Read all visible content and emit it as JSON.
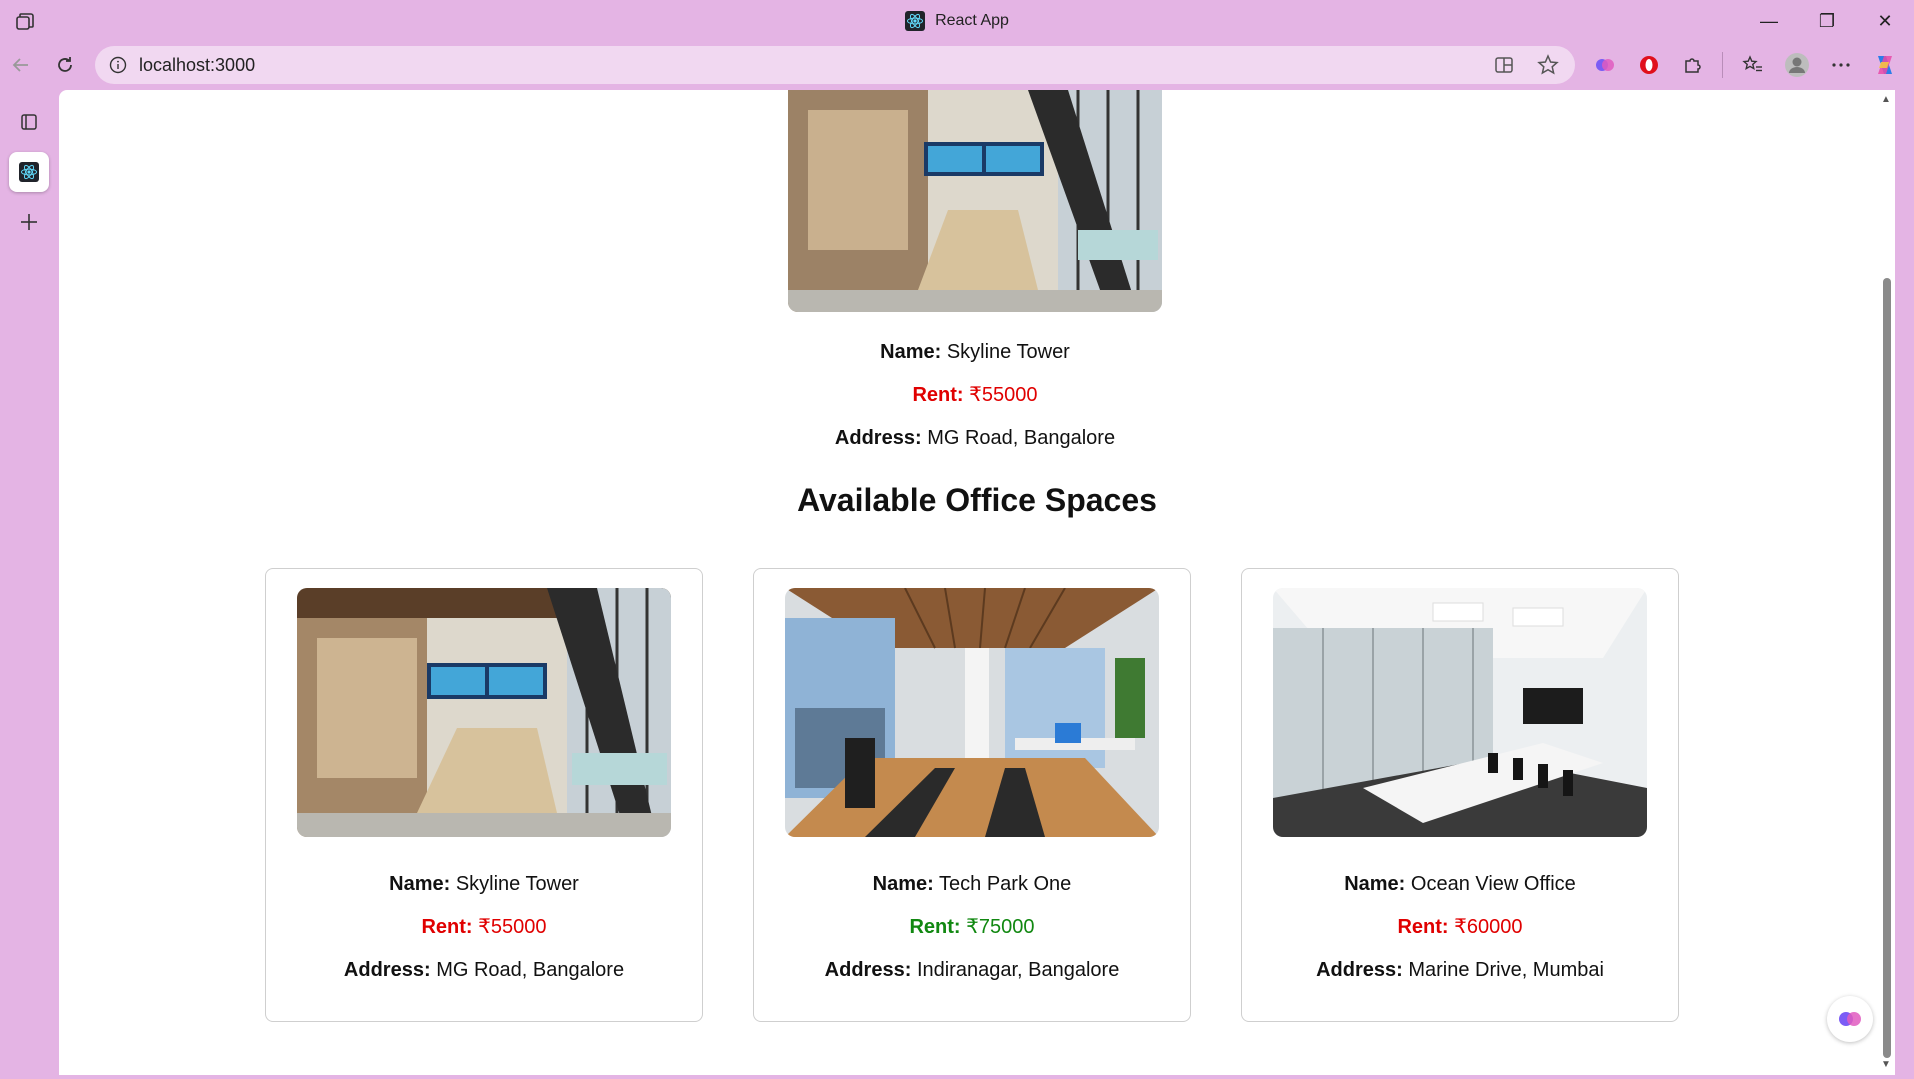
{
  "window": {
    "title": "React App",
    "controls": {
      "minimize": "—",
      "restore": "❐",
      "close": "✕"
    }
  },
  "toolbar": {
    "url": "localhost:3000"
  },
  "featured": {
    "name_label": "Name:",
    "name": "Skyline Tower",
    "rent_label": "Rent:",
    "rent": "₹55000",
    "address_label": "Address:",
    "address": "MG Road, Bangalore"
  },
  "section": {
    "title": "Available Office Spaces"
  },
  "offices": [
    {
      "name_label": "Name:",
      "name": "Skyline Tower",
      "rent_label": "Rent:",
      "rent": "₹55000",
      "rent_color": "#e00000",
      "address_label": "Address:",
      "address": "MG Road, Bangalore"
    },
    {
      "name_label": "Name:",
      "name": "Tech Park One",
      "rent_label": "Rent:",
      "rent": "₹75000",
      "rent_color": "#118811",
      "address_label": "Address:",
      "address": "Indiranagar, Bangalore"
    },
    {
      "name_label": "Name:",
      "name": "Ocean View Office",
      "rent_label": "Rent:",
      "rent": "₹60000",
      "rent_color": "#e00000",
      "address_label": "Address:",
      "address": "Marine Drive, Mumbai"
    }
  ],
  "icons": {
    "workspaces": "workspaces-icon",
    "back": "back-arrow-icon",
    "refresh": "refresh-icon",
    "info": "site-info-icon",
    "split_screen": "split-screen-icon",
    "favorite": "favorite-star-icon",
    "copilot": "copilot-icon"
  }
}
